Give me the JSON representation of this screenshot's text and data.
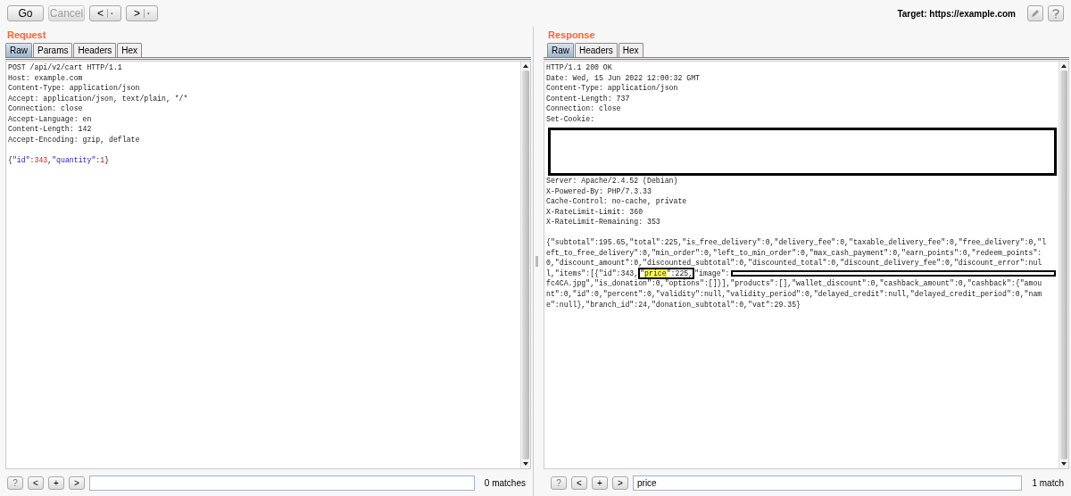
{
  "toolbar": {
    "buttons": [
      {
        "label": "Go",
        "disabled": false
      },
      {
        "label": "Cancel",
        "disabled": true
      },
      {
        "label": "<",
        "disabled": false
      },
      {
        "label": ">",
        "disabled": false
      }
    ],
    "target": "Target: https://example.com"
  },
  "panes": [
    {
      "title": "Request",
      "tabs": [
        {
          "label": "Raw",
          "selected": true
        },
        {
          "label": "Params",
          "selected": false
        },
        {
          "label": "Headers",
          "selected": false
        },
        {
          "label": "Hex",
          "selected": false
        }
      ],
      "lines": [
        [
          {
            "text": "POST /api/v2/cart HTTP/1.1",
            "kind": "plain"
          }
        ],
        [
          {
            "text": "Host: example.com",
            "kind": "plain"
          }
        ],
        [
          {
            "text": "Content-Type: application/json",
            "kind": "plain"
          }
        ],
        [
          {
            "text": "Accept: application/json, text/plain, */*",
            "kind": "plain"
          }
        ],
        [
          {
            "text": "Connection: close",
            "kind": "plain"
          }
        ],
        [
          {
            "text": "Accept-Language: en",
            "kind": "plain"
          }
        ],
        [
          {
            "text": "Content-Length: 142",
            "kind": "plain"
          }
        ],
        [
          {
            "text": "Accept-Encoding: gzip, deflate",
            "kind": "plain"
          }
        ],
        [
          {
            "kind": "blank"
          }
        ],
        [
          {
            "text": "{",
            "kind": "plain"
          },
          {
            "text": "\"id\"",
            "kind": "key"
          },
          {
            "text": ":",
            "kind": "plain"
          },
          {
            "text": "343",
            "kind": "number"
          },
          {
            "text": ",",
            "kind": "plain"
          },
          {
            "text": "\"quantity\"",
            "kind": "key"
          },
          {
            "text": ":",
            "kind": "plain"
          },
          {
            "text": "1",
            "kind": "number"
          },
          {
            "text": "}",
            "kind": "plain"
          }
        ]
      ],
      "search": {
        "buttons": [
          "?",
          "<",
          "+",
          ">"
        ],
        "result": "0 matches"
      }
    },
    {
      "title": "Response",
      "tabs": [
        {
          "label": "Raw",
          "selected": true
        },
        {
          "label": "Headers",
          "selected": false
        },
        {
          "label": "Hex",
          "selected": false
        }
      ],
      "lines": [
        [
          {
            "text": "HTTP/1.1 200 OK",
            "kind": "plain"
          }
        ],
        [
          {
            "text": "Date: Wed, 15 Jun 2022 12:00:32 GMT",
            "kind": "plain"
          }
        ],
        [
          {
            "text": "Content-Type: application/json",
            "kind": "plain"
          }
        ],
        [
          {
            "text": "Content-Length: 737",
            "kind": "plain"
          }
        ],
        [
          {
            "text": "Connection: close",
            "kind": "plain"
          }
        ],
        [
          {
            "text": "Set-Cookie:",
            "kind": "plain"
          }
        ],
        [
          {
            "kind": "redacted-block"
          }
        ],
        [
          {
            "kind": "blank"
          }
        ],
        [
          {
            "kind": "blank"
          }
        ],
        [
          {
            "kind": "blank"
          }
        ],
        [
          {
            "kind": "blank"
          }
        ],
        [
          {
            "text": "Server: Apache/2.4.52 (Debian)",
            "kind": "plain"
          }
        ],
        [
          {
            "text": "X-Powered-By: PHP/7.3.33",
            "kind": "plain"
          }
        ],
        [
          {
            "text": "Cache-Control: no-cache, private",
            "kind": "plain"
          }
        ],
        [
          {
            "text": "X-RateLimit-Limit: 360",
            "kind": "plain"
          }
        ],
        [
          {
            "text": "X-RateLimit-Remaining: 353",
            "kind": "plain"
          }
        ],
        [
          {
            "kind": "blank"
          }
        ],
        [
          {
            "text": "{\"subtotal\":195.65,\"total\":225,\"is_free_delivery\":0,\"delivery_fee\":0,\"taxable_delivery_fee\":0,\"free_delivery\":0,\"l",
            "kind": "plain"
          }
        ],
        [
          {
            "text": "eft_to_free_delivery\":0,\"min_order\":0,\"left_to_min_order\":0,\"max_cash_payment\":0,\"earn_points\":0,\"redeem_points\":",
            "kind": "plain"
          }
        ],
        [
          {
            "text": "0,\"discount_amount\":0,\"discounted_subtotal\":0,\"discounted_total\":0,\"discount_delivery_fee\":0,\"discount_error\":nul",
            "kind": "plain"
          }
        ],
        [
          {
            "text": "l,\"items\":[{\"id\":343,",
            "kind": "plain"
          },
          {
            "text": "\"",
            "kind": "boxed"
          },
          {
            "text": "price",
            "kind": "match"
          },
          {
            "text": "\":225,",
            "kind": "boxed"
          },
          {
            "text": "\"image\":",
            "kind": "plain"
          },
          {
            "kind": "redacted-bar"
          }
        ],
        [
          {
            "text": "fc4CA.jpg\",\"is_donation\":0,\"options\":[]}],\"products\":[],\"wallet_discount\":0,\"cashback_amount\":0,\"cashback\":{\"amou",
            "kind": "plain"
          }
        ],
        [
          {
            "text": "nt\":0,\"id\":0,\"percent\":0,\"validity\":null,\"validity_period\":0,\"delayed_credit\":null,\"delayed_credit_period\":0,\"nam",
            "kind": "plain"
          }
        ],
        [
          {
            "text": "e\":null},\"branch_id\":24,\"donation_subtotal\":0,\"vat\":29.35}",
            "kind": "plain"
          }
        ]
      ],
      "search": {
        "buttons": [
          "?",
          "<",
          "+",
          ">"
        ],
        "value": "price",
        "result": "1 match"
      }
    }
  ]
}
